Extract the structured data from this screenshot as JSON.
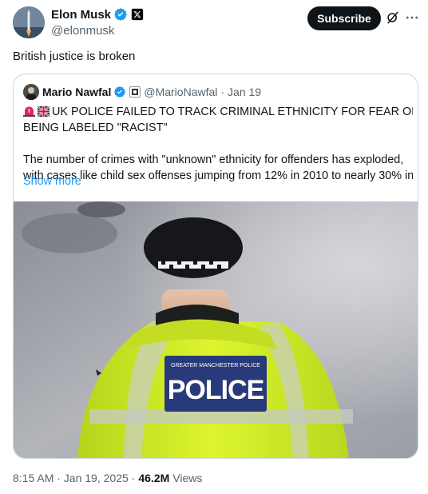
{
  "post": {
    "author_name": "Elon Musk",
    "author_handle": "@elonmusk",
    "subscribe_label": "Subscribe",
    "text": "British justice is broken",
    "timestamp": "8:15 AM · Jan 19, 2025 ·",
    "views_count": "46.2M",
    "views_label": "Views"
  },
  "quote": {
    "author_name": "Mario Nawfal",
    "author_handle": "@MarioNawfal",
    "separator": "·",
    "date": "Jan 19",
    "line1": "UK POLICE FAILED TO TRACK CRIMINAL ETHNICITY FOR FEAR OF",
    "line2": "BEING LABELED \"RACIST\"",
    "line3": "The number of crimes with \"unknown\" ethnicity for offenders has exploded,",
    "line4": "with cases like child sex offenses jumping from 12% in 2010 to nearly 30% in ...",
    "show_more": "Show more",
    "image": {
      "vest_top_text": "GREATER MANCHESTER POLICE",
      "vest_main_text": "POLICE"
    }
  },
  "icons": {
    "verified": "verified-badge-icon",
    "affiliation": "x-logo-icon",
    "grok": "grok-icon",
    "more": "more-icon",
    "alarm": "police-light-icon",
    "flag": "uk-flag-icon"
  },
  "colors": {
    "verified_blue": "#1d9bf0",
    "link_blue": "#1d9bf0",
    "text": "#0f1419",
    "muted": "#536471",
    "border": "#cfd9de",
    "hi_vis": "#d4f22a"
  }
}
